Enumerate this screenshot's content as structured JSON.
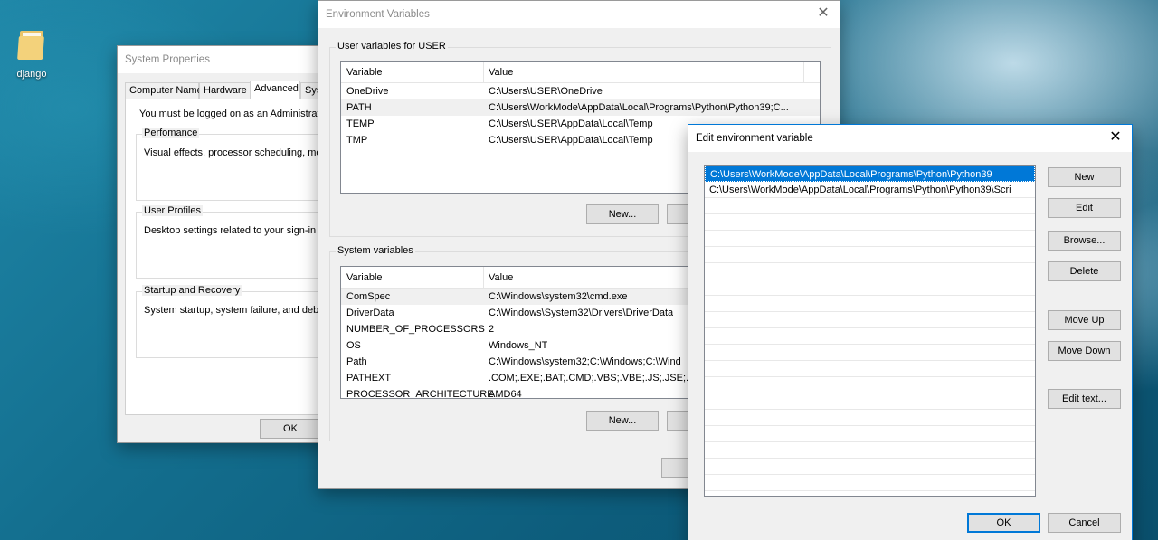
{
  "desktop": {
    "icon_label": "django"
  },
  "system_properties": {
    "title": "System Properties",
    "tabs": [
      "Computer Name",
      "Hardware",
      "Advanced",
      "Sys"
    ],
    "admin_note": "You must be logged on as an Administrator to",
    "performance": {
      "label": "Perfomance",
      "desc": "Visual effects, processor scheduling, memor"
    },
    "user_profiles": {
      "label": "User Profiles",
      "desc": "Desktop settings related to your sign-in"
    },
    "startup": {
      "label": "Startup and Recovery",
      "desc": "System startup, system failure, and debuggin"
    },
    "ok_label": "OK"
  },
  "env_vars": {
    "title": "Environment Variables",
    "user_group_label": "User variables for USER",
    "system_group_label": "System variables",
    "col_variable": "Variable",
    "col_value": "Value",
    "user_vars": [
      {
        "name": "OneDrive",
        "value": "C:\\Users\\USER\\OneDrive"
      },
      {
        "name": "PATH",
        "value": "C:\\Users\\WorkMode\\AppData\\Local\\Programs\\Python\\Python39;C..."
      },
      {
        "name": "TEMP",
        "value": "C:\\Users\\USER\\AppData\\Local\\Temp"
      },
      {
        "name": "TMP",
        "value": "C:\\Users\\USER\\AppData\\Local\\Temp"
      }
    ],
    "system_vars": [
      {
        "name": "ComSpec",
        "value": "C:\\Windows\\system32\\cmd.exe"
      },
      {
        "name": "DriverData",
        "value": "C:\\Windows\\System32\\Drivers\\DriverData"
      },
      {
        "name": "NUMBER_OF_PROCESSORS",
        "value": "2"
      },
      {
        "name": "OS",
        "value": "Windows_NT"
      },
      {
        "name": "Path",
        "value": "C:\\Windows\\system32;C:\\Windows;C:\\Wind"
      },
      {
        "name": "PATHEXT",
        "value": ".COM;.EXE;.BAT;.CMD;.VBS;.VBE;.JS;.JSE;.WSF"
      },
      {
        "name": "PROCESSOR_ARCHITECTURE",
        "value": "AMD64"
      }
    ],
    "new_label": "New..."
  },
  "edit_env": {
    "title": "Edit environment variable",
    "entries": [
      "C:\\Users\\WorkMode\\AppData\\Local\\Programs\\Python\\Python39",
      "C:\\Users\\WorkMode\\AppData\\Local\\Programs\\Python\\Python39\\Scri"
    ],
    "buttons": {
      "new": "New",
      "edit": "Edit",
      "browse": "Browse...",
      "delete": "Delete",
      "move_up": "Move Up",
      "move_down": "Move Down",
      "edit_text": "Edit text...",
      "ok": "OK",
      "cancel": "Cancel"
    },
    "accent_color": "#0078d7"
  }
}
